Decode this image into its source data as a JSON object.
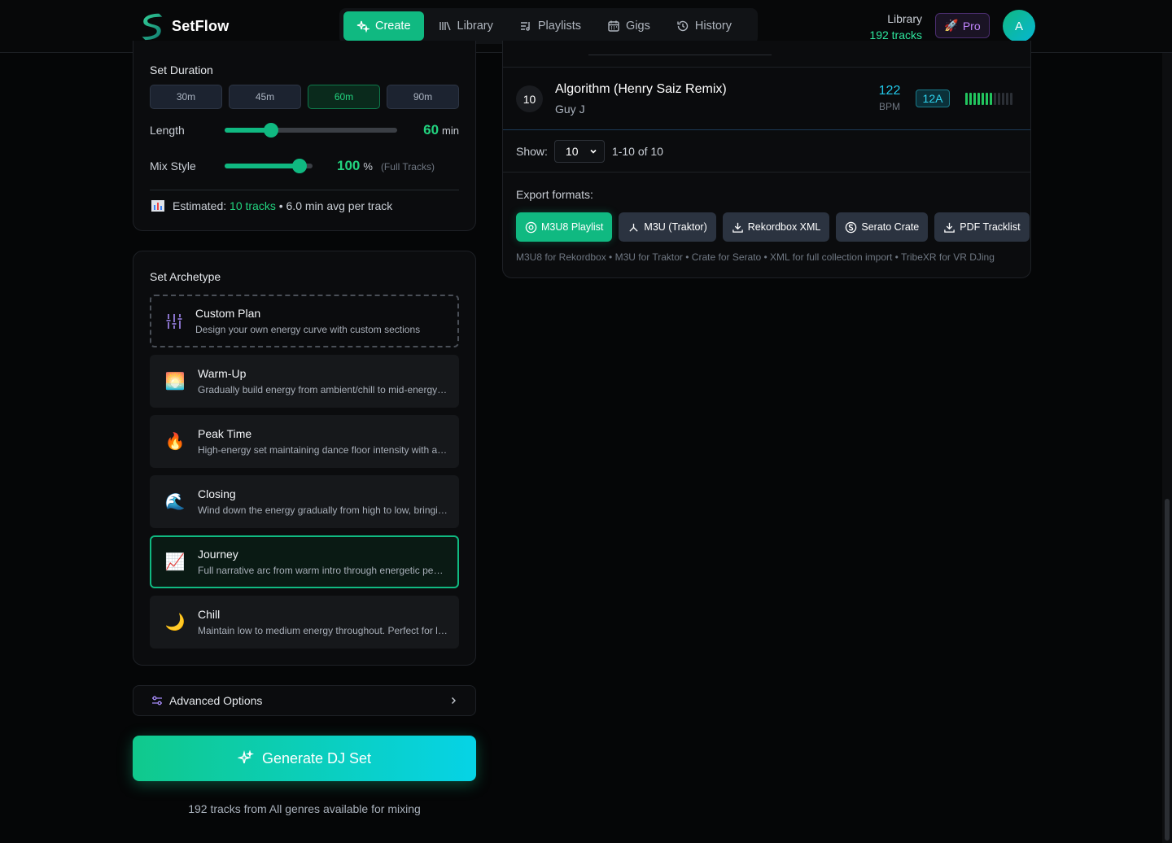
{
  "app": {
    "name": "SetFlow"
  },
  "nav": {
    "items": [
      {
        "label": "Create",
        "icon": "sparkles-icon",
        "active": true
      },
      {
        "label": "Library",
        "icon": "library-icon",
        "active": false
      },
      {
        "label": "Playlists",
        "icon": "playlist-icon",
        "active": false
      },
      {
        "label": "Gigs",
        "icon": "calendar-icon",
        "active": false
      },
      {
        "label": "History",
        "icon": "history-icon",
        "active": false
      }
    ]
  },
  "library": {
    "label": "Library",
    "count": "192 tracks"
  },
  "pro": {
    "label": "Pro",
    "icon": "rocket-icon"
  },
  "user": {
    "initial": "A"
  },
  "duration": {
    "title": "Set Duration",
    "options": [
      "30m",
      "45m",
      "60m",
      "90m"
    ],
    "selected": "60m",
    "length": {
      "label": "Length",
      "value": "60",
      "unit": "min",
      "fraction": 0.27
    },
    "mix": {
      "label": "Mix Style",
      "value": "100",
      "unit": "%",
      "note": "(Full Tracks)",
      "fraction": 0.85
    },
    "estimate": {
      "prefix": "Estimated:",
      "tracks": "10 tracks",
      "suffix": "• 6.0 min avg per track"
    }
  },
  "archetype": {
    "title": "Set Archetype",
    "items": [
      {
        "title": "Custom Plan",
        "desc": "Design your own energy curve with custom sections",
        "icon": "sliders-icon",
        "style": "custom"
      },
      {
        "title": "Warm-Up",
        "desc": "Gradually build energy from ambient/chill to mid-energy grooves",
        "icon": "sunrise-icon",
        "emoji": "🌅"
      },
      {
        "title": "Peak Time",
        "desc": "High-energy set maintaining dance floor intensity with a steady drive",
        "icon": "fire-icon",
        "emoji": "🔥"
      },
      {
        "title": "Closing",
        "desc": "Wind down the energy gradually from high to low, bringing the night home",
        "icon": "wave-icon",
        "emoji": "🌊"
      },
      {
        "title": "Journey",
        "desc": "Full narrative arc from warm intro through energetic peaks and back",
        "icon": "chart-up-icon",
        "emoji": "📈",
        "style": "selected"
      },
      {
        "title": "Chill",
        "desc": "Maintain low to medium energy throughout. Perfect for lounges",
        "icon": "moon-icon",
        "emoji": "🌙"
      }
    ]
  },
  "advanced": {
    "label": "Advanced Options"
  },
  "generate": {
    "label": "Generate DJ Set",
    "note": "192 tracks from All genres available for mixing"
  },
  "track": {
    "number": "10",
    "title": "Algorithm (Henry Saiz Remix)",
    "artist": "Guy J",
    "bpm": "122",
    "bpm_unit": "BPM",
    "key": "12A",
    "energy_level": 7,
    "energy_max": 12
  },
  "pagination": {
    "show_label": "Show:",
    "page_size": "10",
    "range": "1-10 of 10"
  },
  "export": {
    "label": "Export formats:",
    "buttons": [
      {
        "label": "M3U8 Playlist",
        "icon": "disc-icon",
        "primary": true
      },
      {
        "label": "M3U (Traktor)",
        "icon": "traktor-icon",
        "primary": false
      },
      {
        "label": "Rekordbox XML",
        "icon": "download-icon",
        "primary": false
      },
      {
        "label": "Serato Crate",
        "icon": "serato-icon",
        "primary": false
      },
      {
        "label": "PDF Tracklist",
        "icon": "download-icon",
        "primary": false
      }
    ],
    "note": "M3U8 for Rekordbox • M3U for Traktor • Crate for Serato • XML for full collection import • TribeXR for VR DJing"
  },
  "colors": {
    "accent": "#10b981",
    "cyan": "#06d3e6",
    "purple": "#c084fc"
  }
}
